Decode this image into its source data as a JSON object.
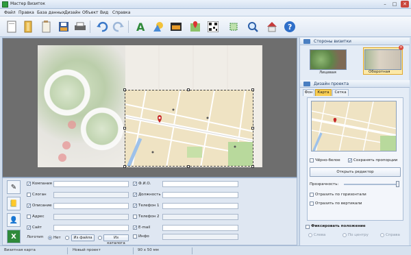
{
  "window": {
    "title": "Мастер Визиток",
    "min": "–",
    "max": "□",
    "close": "✕"
  },
  "menu": [
    "Файл",
    "Правка",
    "База данных",
    "Дизайн",
    "Объект",
    "Вид",
    "Справка"
  ],
  "toolbar_icons": [
    "new-icon",
    "open-icon",
    "templates-icon",
    "save-icon",
    "print-icon",
    "undo-icon",
    "redo-icon",
    "text-icon",
    "shapes-icon",
    "image-icon",
    "map-icon",
    "qrcode-icon",
    "crop-icon",
    "zoom-icon",
    "export-icon",
    "help-icon"
  ],
  "fields_left": [
    {
      "label": "Компания",
      "checked": true
    },
    {
      "label": "Слоган",
      "checked": false
    },
    {
      "label": "Описание",
      "checked": true
    },
    {
      "label": "Адрес",
      "checked": false
    },
    {
      "label": "Сайт",
      "checked": true
    }
  ],
  "fields_right": [
    {
      "label": "Ф.И.О.",
      "checked": true
    },
    {
      "label": "Должность",
      "checked": true
    },
    {
      "label": "Телефон 1",
      "checked": true
    },
    {
      "label": "Телефон 2",
      "checked": false
    },
    {
      "label": "E-mail",
      "checked": true
    },
    {
      "label": "Инфо",
      "checked": false
    }
  ],
  "logo": {
    "label": "Логотип",
    "options": [
      "Нет",
      "Из файла",
      "Из каталога"
    ],
    "selected": 0
  },
  "right": {
    "sides_header": "Стороны визитки",
    "front": "Лицевая",
    "back": "Оборотная",
    "design_header": "Дизайн проекта",
    "tabs": [
      "Фон",
      "Карта",
      "Сетка"
    ],
    "active_tab": 1,
    "bw": "Чёрно-белое",
    "keep_ratio": "Сохранять пропорции",
    "open_editor": "Открыть редактор",
    "opacity": "Прозрачность:",
    "flip_h": "Отразить по горизонтали",
    "flip_v": "Отразить по вертикали",
    "fix_position": "Фиксировать положение",
    "align": [
      "Слева",
      "По центру",
      "Справа"
    ]
  },
  "status": {
    "type": "Визитная карта",
    "project": "Новый проект",
    "size": "90 x 50 мм"
  },
  "colors": {
    "accent": "#f9ce53",
    "panel": "#e4ecf6",
    "titlebar": "#d2e0f1"
  }
}
